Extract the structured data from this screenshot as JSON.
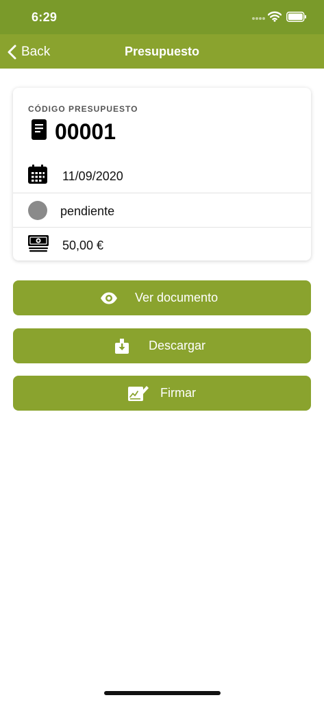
{
  "status_bar": {
    "time": "6:29"
  },
  "nav": {
    "back_label": "Back",
    "title": "Presupuesto"
  },
  "card": {
    "code_label": "CÓDIGO PRESUPUESTO",
    "code_value": "00001",
    "date": "11/09/2020",
    "status": "pendiente",
    "amount": "50,00 €"
  },
  "actions": {
    "view_label": "Ver documento",
    "download_label": "Descargar",
    "sign_label": "Firmar"
  },
  "colors": {
    "status_bar_bg": "#7a9a2a",
    "nav_bg": "#8aa32e",
    "button_bg": "#8aa32e",
    "status_dot": "#8a8a8a"
  },
  "icons": {
    "code": "document-icon",
    "date": "calendar-icon",
    "status": "status-dot-icon",
    "amount": "money-icon",
    "view": "eye-icon",
    "download": "download-icon",
    "sign": "signature-icon"
  }
}
